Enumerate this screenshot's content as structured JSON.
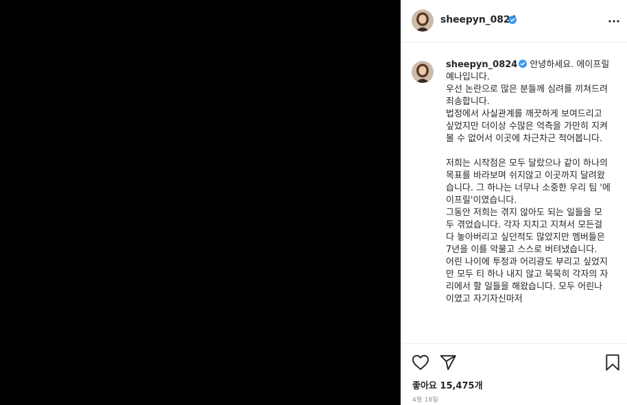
{
  "post": {
    "username": "sheepyn_0824",
    "verified_icon": "verified-badge-icon",
    "more_icon": "more-options-icon"
  },
  "caption": {
    "username": "sheepyn_0824",
    "text": "안녕하세요. 에이프릴 예나입니다.\n우선 논란으로 많은 분들께 심려를 끼쳐드려 죄송합니다.\n법정에서 사실관계를 깨끗하게 보여드리고 싶었지만 더이상 수많은 억측을 가만히 지켜 볼 수 없어서 이곳에 차근차근 적어봅니다.\n\n저희는 시작점은 모두 달랐으나 같이 하나의 목표를 바라보며 쉬지않고 이곳까지 달려왔습니다. 그 하나는 너무나 소중한 우리 팀 '에이프릴'이였습니다.\n그동안 저희는 겪지 않아도 되는 일들을 모두 겪었습니다. 각자 지치고 지쳐서 모든걸 다 놓아버리고 싶던적도 많았지만 멤버들은 7년을 이를 악물고 스스로 버텨냈습니다.\n어린 나이에 투정과 어리광도 부리고 싶었지만 모두 티 하나 내지 않고 묵묵히 각자의 자리에서 할 일들을 해왔습니다. 모두 어린나이였고 자기자신마저"
  },
  "actions": {
    "like_icon": "heart-icon",
    "share_icon": "paper-plane-icon",
    "save_icon": "bookmark-icon"
  },
  "likes_text": "좋아요 15,475개",
  "date_text": "4월 18일",
  "colors": {
    "media_bg": "#000000",
    "text": "#262626",
    "muted": "#8e8e8e",
    "verified": "#3897f0",
    "divider": "#efefef"
  }
}
